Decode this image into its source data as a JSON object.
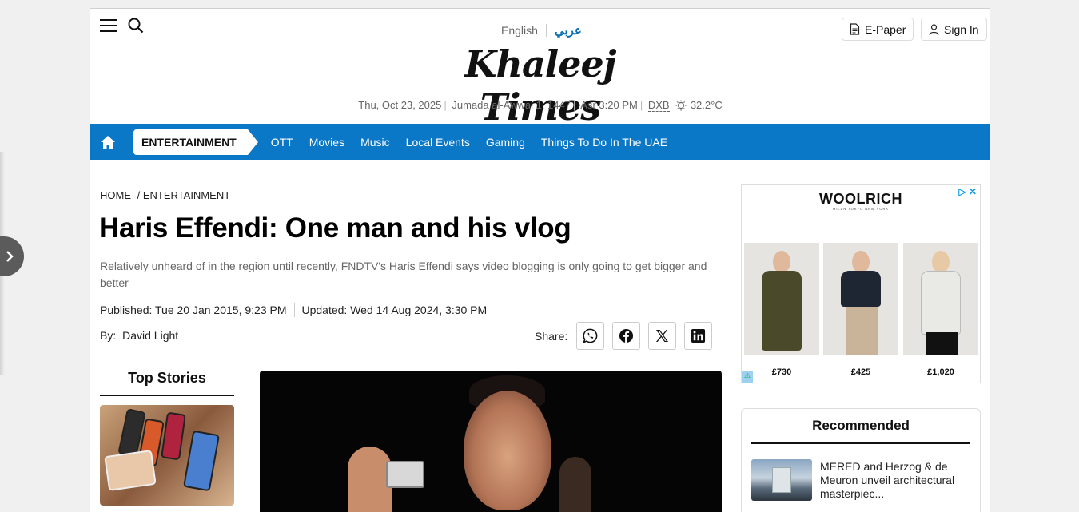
{
  "header": {
    "lang_english": "English",
    "lang_arabic": "عربي",
    "logo_text": "Khaleej Times",
    "date": "Thu, Oct 23, 2025",
    "hijri_date": "Jumada al-Awwal 1, 1447",
    "prayer": "Asr 3:20 PM",
    "location": "DXB",
    "temperature": "32.2°C",
    "epaper_label": "E-Paper",
    "signin_label": "Sign In"
  },
  "nav": {
    "active": "ENTERTAINMENT",
    "items": [
      "OTT",
      "Movies",
      "Music",
      "Local Events",
      "Gaming",
      "Things To Do In The UAE"
    ]
  },
  "article": {
    "breadcrumb_home": "HOME",
    "breadcrumb_section": "/ ENTERTAINMENT",
    "headline": "Haris Effendi: One man and his vlog",
    "summary": "Relatively unheard of in the region until recently, FNDTV's Haris Effendi says video blogging is only going to get bigger and better",
    "published": "Published: Tue 20 Jan 2015, 9:23 PM",
    "updated": "Updated: Wed 14 Aug 2024, 3:30 PM",
    "by_label": "By:",
    "author": "David Light",
    "share_label": "Share:"
  },
  "top_stories": {
    "title": "Top Stories"
  },
  "ad": {
    "brand": "WOOLRICH",
    "tagline": "MILAN TOKYO NEW YORK",
    "prices": [
      "£730",
      "£425",
      "£1,020"
    ]
  },
  "recommended": {
    "title": "Recommended",
    "item_text": "MERED and Herzog & de Meuron unveil architectural masterpiec..."
  },
  "colors": {
    "nav_blue": "#0a77c7",
    "arabic_link": "#0a6fb5"
  }
}
